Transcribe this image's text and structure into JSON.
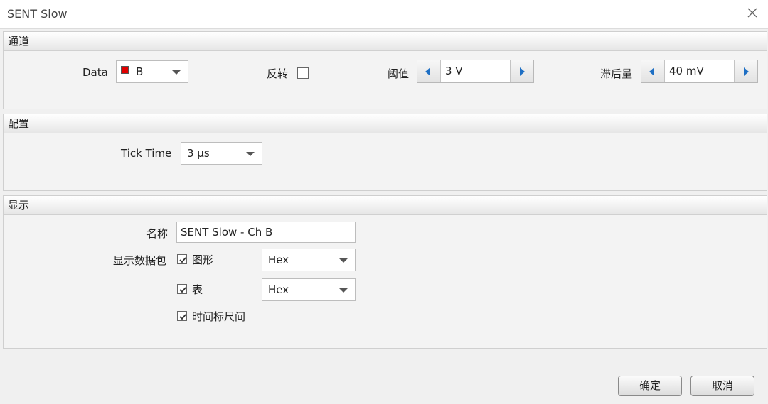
{
  "window": {
    "title": "SENT Slow"
  },
  "channel": {
    "header": "通道",
    "data_label": "Data",
    "data_value": "B",
    "swatch_color": "#e00000",
    "invert_label": "反转",
    "invert_checked": false,
    "threshold_label": "阈值",
    "threshold_value": "3 V",
    "hysteresis_label": "滞后量",
    "hysteresis_value": "40 mV"
  },
  "config": {
    "header": "配置",
    "tick_time_label": "Tick Time",
    "tick_time_value": "3 µs"
  },
  "display": {
    "header": "显示",
    "name_label": "名称",
    "name_value": "SENT Slow - Ch B",
    "packets_label": "显示数据包",
    "graph_label": "图形",
    "graph_checked": true,
    "graph_format": "Hex",
    "table_label": "表",
    "table_checked": true,
    "table_format": "Hex",
    "timeline_label": "时间标尺间",
    "timeline_checked": true
  },
  "footer": {
    "ok_label": "确定",
    "cancel_label": "取消"
  },
  "colors": {
    "spin_arrow": "#1e6fc4",
    "swatch": "#e00000"
  }
}
